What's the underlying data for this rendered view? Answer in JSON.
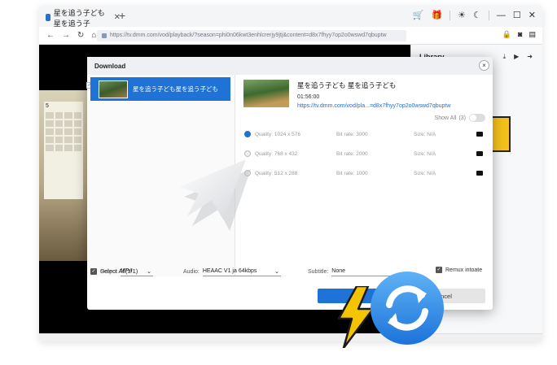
{
  "browser": {
    "tab_title": "星を追う子ども 星を追う子",
    "tab_close": "✕",
    "new_tab": "+",
    "url": "https://tv.dmm.com/vod/playback/?season=phi0n06kwt3enhlcrerjy9jtj&content=d8x7fhyy7op2o0wswd7qbuptw",
    "nav_back": "←",
    "nav_forward": "→",
    "nav_reload": "↻",
    "nav_home": "⌂",
    "titlebar_icons": [
      "cart-icon",
      "gift-icon",
      "sun-icon",
      "moon-icon",
      "minimize-icon",
      "maximize-icon",
      "close-icon"
    ]
  },
  "page": {
    "calendar_title": "5"
  },
  "library": {
    "title": "Library"
  },
  "dialog": {
    "title": "Download",
    "close": "×",
    "item": {
      "title": "星を追う子ども星を追う子ども"
    },
    "select_all": "Select All(1/1)",
    "detail": {
      "title": "星を追う子ども 星を追う子ども",
      "duration": "01:56:00",
      "url": "https://tv.dmm.com/vod/pla...=d8x7fhyy7op2o0wswd7qbuptw",
      "show_all": "Show All",
      "show_all_count": "(3)"
    },
    "qualities": [
      {
        "quality": "Quality: 1024 x 576",
        "bitrate": "Bit rate: 3000",
        "size": "Size: N/A",
        "selected": true
      },
      {
        "quality": "Quality: 768 x 432",
        "bitrate": "Bit rate: 2000",
        "size": "Size: N/A",
        "selected": false
      },
      {
        "quality": "Quality: 512 x 288",
        "bitrate": "Bit rate: 1000",
        "size": "Size: N/A",
        "selected": false
      }
    ],
    "output_label": "Output",
    "output_value": "MP4",
    "audio_label": "Audio:",
    "audio_value": "HEAAC V1 ja 64kbps",
    "subtitle_label": "Subtitle:",
    "subtitle_value": "None",
    "remux_label": "Remux intoate",
    "download_label": "D",
    "cancel_label": "ncel"
  },
  "colors": {
    "accent": "#1f72d6",
    "bolt": "#f5c400",
    "sync": "#2d8de8"
  }
}
